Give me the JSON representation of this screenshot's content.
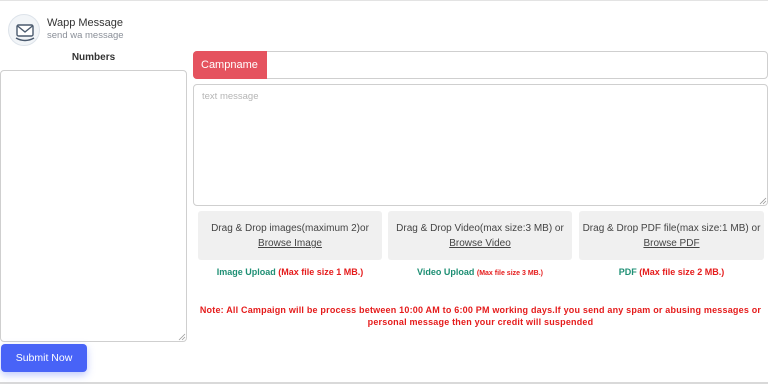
{
  "brand": {
    "title": "Wapp Message",
    "subtitle": "send wa message",
    "logo_icon": "envelope-chat-icon"
  },
  "numbers": {
    "label": "Numbers",
    "value": ""
  },
  "campaign": {
    "label": "Campname",
    "value": "",
    "label_color": "#e5535f"
  },
  "message": {
    "placeholder": "text message",
    "value": ""
  },
  "uploads": {
    "image": {
      "drop_text": "Drag & Drop images(maximum 2)or",
      "browse_label": "Browse Image",
      "caption_type": "Image Upload",
      "caption_limit": "(Max file size 1 MB.)"
    },
    "video": {
      "drop_text": "Drag & Drop Video(max size:3 MB) or",
      "browse_label": "Browse Video",
      "caption_type": "Video Upload",
      "caption_limit": "(Max file size 3 MB.)"
    },
    "pdf": {
      "drop_text": "Drag & Drop PDF file(max size:1 MB) or",
      "browse_label": "Browse PDF",
      "caption_type": "PDF",
      "caption_limit": "(Max file size 2 MB.)"
    }
  },
  "note": "Note: All Campaign will be process between 10:00 AM to 6:00 PM working days.If you send any spam or abusing messages or personal message then your credit will suspended",
  "submit_label": "Submit Now",
  "colors": {
    "accent": "#4863f7",
    "campname": "#e5535f",
    "caption_green": "#1e8f74",
    "warning_red": "#e51b1b"
  }
}
